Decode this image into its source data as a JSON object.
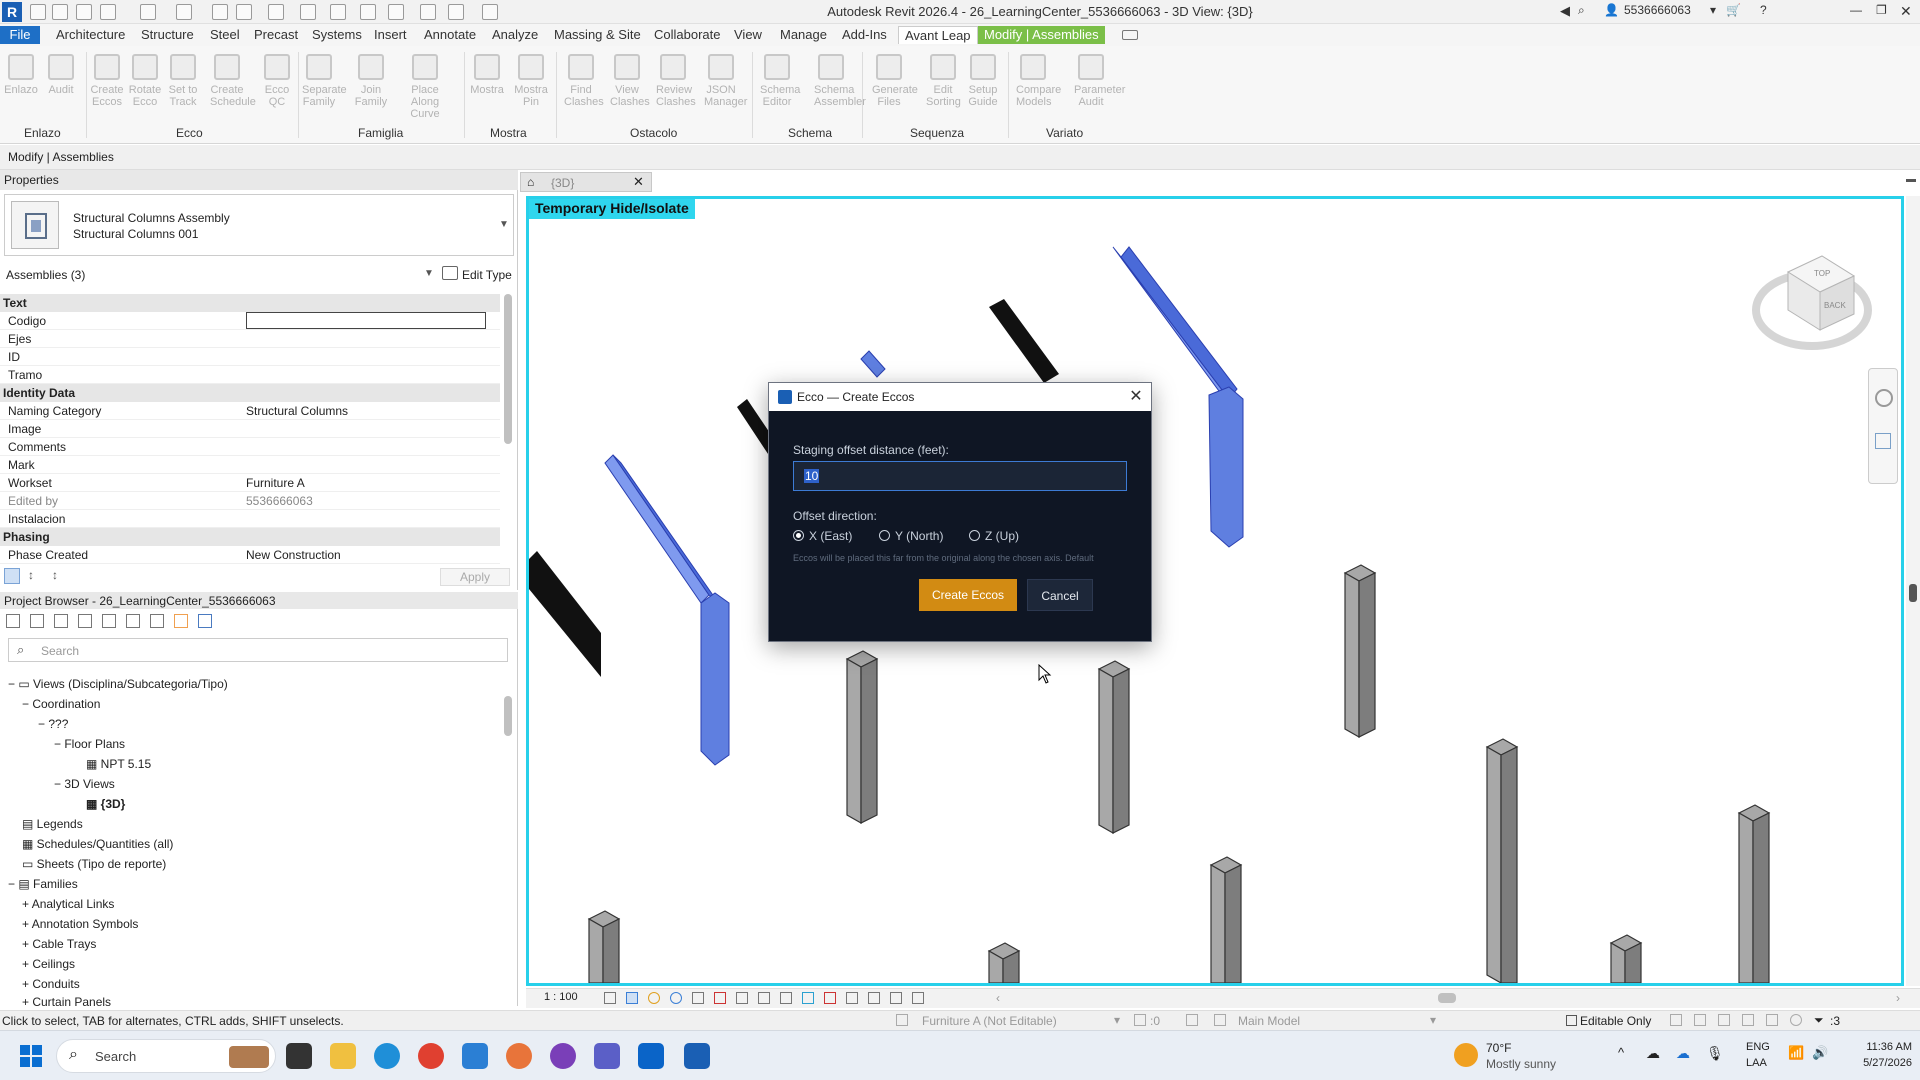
{
  "window": {
    "title": "Autodesk Revit 2026.4 - 26_LearningCenter_5536666063 - 3D View: {3D}",
    "user_id": "5536666063",
    "logo_letter": "R"
  },
  "ribbon_tabs": [
    "File",
    "Architecture",
    "Structure",
    "Steel",
    "Precast",
    "Systems",
    "Insert",
    "Annotate",
    "Analyze",
    "Massing & Site",
    "Collaborate",
    "View",
    "Manage",
    "Add-Ins",
    "Avant Leap",
    "Modify | Assemblies"
  ],
  "ribbon_panels": [
    {
      "name": "Enlazo",
      "buttons": [
        "Enlazo",
        "Audit"
      ]
    },
    {
      "name": "Ecco",
      "buttons": [
        "Create Eccos",
        "Rotate Ecco",
        "Set to Track",
        "Create Schedule",
        "Ecco QC"
      ]
    },
    {
      "name": "Famiglia",
      "buttons": [
        "Separate Family",
        "Join Family",
        "Place Along Curve"
      ]
    },
    {
      "name": "Mostra",
      "buttons": [
        "Mostra",
        "Mostra Pin"
      ]
    },
    {
      "name": "Ostacolo",
      "buttons": [
        "Find Clashes",
        "View Clashes",
        "Review Clashes",
        "JSON Manager"
      ]
    },
    {
      "name": "Schema",
      "buttons": [
        "Schema Editor",
        "Schema Assembler"
      ]
    },
    {
      "name": "Sequenza",
      "buttons": [
        "Generate Files",
        "Edit Sorting",
        "Setup Guide"
      ]
    },
    {
      "name": "Variato",
      "buttons": [
        "Compare Models",
        "Parameter Audit"
      ]
    }
  ],
  "context_label": "Modify | Assemblies",
  "properties": {
    "header": "Properties",
    "type_line1": "Structural Columns Assembly",
    "type_line2": "Structural Columns 001",
    "selection": "Assemblies (3)",
    "edit_type": "Edit Type",
    "apply": "Apply",
    "groups": [
      {
        "name": "Text",
        "rows": [
          [
            "Codigo",
            ""
          ],
          [
            "Ejes",
            ""
          ],
          [
            "ID",
            ""
          ],
          [
            "Tramo",
            ""
          ]
        ]
      },
      {
        "name": "Identity Data",
        "rows": [
          [
            "Naming Category",
            "Structural Columns"
          ],
          [
            "Image",
            ""
          ],
          [
            "Comments",
            ""
          ],
          [
            "Mark",
            ""
          ],
          [
            "Workset",
            "Furniture A"
          ],
          [
            "Edited by",
            "5536666063"
          ],
          [
            "Instalacion",
            ""
          ]
        ]
      },
      {
        "name": "Phasing",
        "rows": [
          [
            "Phase Created",
            "New Construction"
          ]
        ]
      }
    ]
  },
  "browser": {
    "header": "Project Browser - 26_LearningCenter_5536666063",
    "search_placeholder": "Search",
    "items": [
      {
        "label": "Views (Disciplina/Subcategoria/Tipo)",
        "indent": 0
      },
      {
        "label": "Coordination",
        "indent": 1
      },
      {
        "label": "???",
        "indent": 2
      },
      {
        "label": "Floor Plans",
        "indent": 3
      },
      {
        "label": "NPT 5.15",
        "indent": 4
      },
      {
        "label": "3D Views",
        "indent": 3
      },
      {
        "label": "{3D}",
        "indent": 4
      },
      {
        "label": "Legends",
        "indent": 1
      },
      {
        "label": "Schedules/Quantities (all)",
        "indent": 1
      },
      {
        "label": "Sheets (Tipo de reporte)",
        "indent": 1
      },
      {
        "label": "Families",
        "indent": 0
      },
      {
        "label": "Analytical Links",
        "indent": 1
      },
      {
        "label": "Annotation Symbols",
        "indent": 1
      },
      {
        "label": "Cable Trays",
        "indent": 1
      },
      {
        "label": "Ceilings",
        "indent": 1
      },
      {
        "label": "Conduits",
        "indent": 1
      },
      {
        "label": "Curtain Panels",
        "indent": 1
      }
    ]
  },
  "view": {
    "tab_label": "{3D}",
    "banner": "Temporary Hide/Isolate",
    "scale": "1 : 100",
    "cube_faces": [
      "TOP",
      "BACK"
    ]
  },
  "dialog": {
    "title": "Ecco — Create Eccos",
    "offset_label": "Staging offset distance (feet):",
    "offset_value": "10",
    "direction_label": "Offset direction:",
    "options": [
      "X (East)",
      "Y (North)",
      "Z (Up)"
    ],
    "selected_option": "X (East)",
    "hint": "Eccos will be placed this far from the original along the chosen axis. Default",
    "create_label": "Create Eccos",
    "cancel_label": "Cancel"
  },
  "status": {
    "message": "Click to select, TAB for alternates, CTRL adds, SHIFT unselects.",
    "workset": "Furniture A (Not Editable)",
    "model": "Main Model",
    "editable_only": "Editable Only",
    "zero": ":0",
    "filter_count": ":3"
  },
  "taskbar": {
    "search_label": "Search",
    "weather_temp": "70°F",
    "weather_desc": "Mostly sunny",
    "lang1": "ENG",
    "lang2": "LAA",
    "time": "11:36 AM",
    "date": "5/27/2026"
  },
  "colors": {
    "accent": "#1e6fc6",
    "modify_tab": "#7bbf48",
    "view_border": "#27d0ea",
    "dialog_bg": "#0f1624",
    "create_button": "#d28b13",
    "blue_column": "#5f7fe0"
  }
}
